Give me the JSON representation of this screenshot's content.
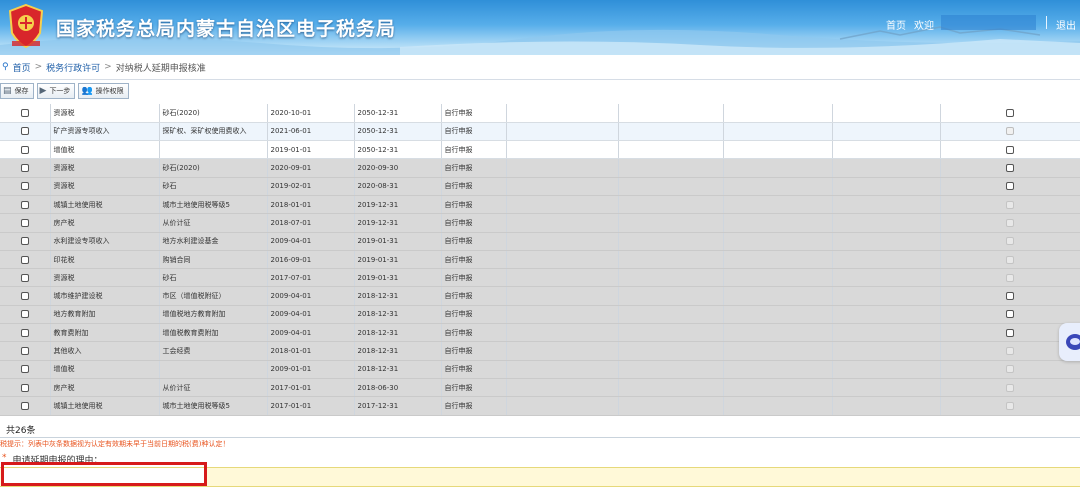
{
  "header": {
    "site_title": "国家税务总局内蒙古自治区电子税务局",
    "home_link": "首页",
    "welcome": "欢迎",
    "logout": "退出"
  },
  "breadcrumb": {
    "items": [
      "首页",
      "税务行政许可",
      "对纳税人延期申报核准"
    ]
  },
  "toolbar": {
    "save": "保存",
    "next": "下一步",
    "permissions": "操作权限"
  },
  "table": {
    "rows": [
      {
        "tax": "资源税",
        "item": "砂石(2020)",
        "start": "2020-10-01",
        "end": "2050-12-31",
        "method": "自行申报",
        "checkbox": "enabled",
        "bg": "white"
      },
      {
        "tax": "矿产资源专项收入",
        "item": "探矿权、采矿权使用费收入",
        "start": "2021-06-01",
        "end": "2050-12-31",
        "method": "自行申报",
        "checkbox": "disabled",
        "bg": "white-alt"
      },
      {
        "tax": "增值税",
        "item": "",
        "start": "2019-01-01",
        "end": "2050-12-31",
        "method": "自行申报",
        "checkbox": "enabled",
        "bg": "white"
      },
      {
        "tax": "资源税",
        "item": "砂石(2020)",
        "start": "2020-09-01",
        "end": "2020-09-30",
        "method": "自行申报",
        "checkbox": "enabled",
        "bg": "gray"
      },
      {
        "tax": "资源税",
        "item": "砂石",
        "start": "2019-02-01",
        "end": "2020-08-31",
        "method": "自行申报",
        "checkbox": "enabled",
        "bg": "gray"
      },
      {
        "tax": "城镇土地使用税",
        "item": "城市土地使用税等级5",
        "start": "2018-01-01",
        "end": "2019-12-31",
        "method": "自行申报",
        "checkbox": "disabled",
        "bg": "gray"
      },
      {
        "tax": "房产税",
        "item": "从价计征",
        "start": "2018-07-01",
        "end": "2019-12-31",
        "method": "自行申报",
        "checkbox": "disabled",
        "bg": "gray"
      },
      {
        "tax": "水利建设专项收入",
        "item": "地方水利建设基金",
        "start": "2009-04-01",
        "end": "2019-01-31",
        "method": "自行申报",
        "checkbox": "disabled",
        "bg": "gray"
      },
      {
        "tax": "印花税",
        "item": "购销合同",
        "start": "2016-09-01",
        "end": "2019-01-31",
        "method": "自行申报",
        "checkbox": "disabled",
        "bg": "gray"
      },
      {
        "tax": "资源税",
        "item": "砂石",
        "start": "2017-07-01",
        "end": "2019-01-31",
        "method": "自行申报",
        "checkbox": "disabled",
        "bg": "gray"
      },
      {
        "tax": "城市维护建设税",
        "item": "市区（增值税附征）",
        "start": "2009-04-01",
        "end": "2018-12-31",
        "method": "自行申报",
        "checkbox": "enabled",
        "bg": "gray"
      },
      {
        "tax": "地方教育附加",
        "item": "增值税地方教育附加",
        "start": "2009-04-01",
        "end": "2018-12-31",
        "method": "自行申报",
        "checkbox": "enabled",
        "bg": "gray"
      },
      {
        "tax": "教育费附加",
        "item": "增值税教育费附加",
        "start": "2009-04-01",
        "end": "2018-12-31",
        "method": "自行申报",
        "checkbox": "enabled",
        "bg": "gray"
      },
      {
        "tax": "其他收入",
        "item": "工会经费",
        "start": "2018-01-01",
        "end": "2018-12-31",
        "method": "自行申报",
        "checkbox": "disabled",
        "bg": "gray"
      },
      {
        "tax": "增值税",
        "item": "",
        "start": "2009-01-01",
        "end": "2018-12-31",
        "method": "自行申报",
        "checkbox": "disabled",
        "bg": "gray"
      },
      {
        "tax": "房产税",
        "item": "从价计征",
        "start": "2017-01-01",
        "end": "2018-06-30",
        "method": "自行申报",
        "checkbox": "disabled",
        "bg": "gray"
      },
      {
        "tax": "城镇土地使用税",
        "item": "城市土地使用税等级5",
        "start": "2017-01-01",
        "end": "2017-12-31",
        "method": "自行申报",
        "checkbox": "disabled",
        "bg": "gray"
      }
    ]
  },
  "footer": {
    "total": "共26条",
    "notice": "税提示：列表中灰条数据视为认定有效期未早于当前日期的税(费)种认定！",
    "reason_star": "*",
    "reason_label": "申请延期申报的理由：",
    "reason_value": ""
  },
  "colors": {
    "accent_blue": "#2f8fd8",
    "notice_orange": "#e8541f",
    "highlight_red": "#d61a1a"
  }
}
